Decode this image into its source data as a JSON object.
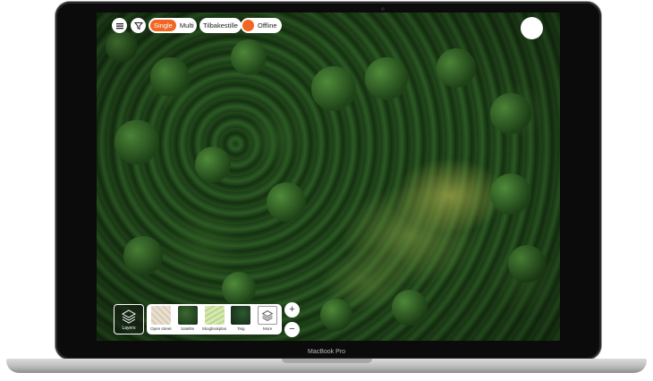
{
  "device": {
    "label": "MacBook Pro"
  },
  "toolbar": {
    "menu_icon": "hamburger-menu-icon",
    "filter_icon": "filter-funnel-icon",
    "mode_toggle": {
      "single_label": "Single",
      "multi_label": "Multi",
      "selected": "Single"
    },
    "reset_label": "Tilbakestille",
    "offline_label": "Offline",
    "accent_color": "#f26522"
  },
  "map_layers": {
    "button_label": "Layers",
    "options": [
      {
        "label": "Open street"
      },
      {
        "label": "Satelite"
      },
      {
        "label": "Skogbrukplan"
      },
      {
        "label": "Teig"
      },
      {
        "label": "More"
      }
    ]
  },
  "zoom": {
    "in_label": "+",
    "out_label": "−"
  }
}
